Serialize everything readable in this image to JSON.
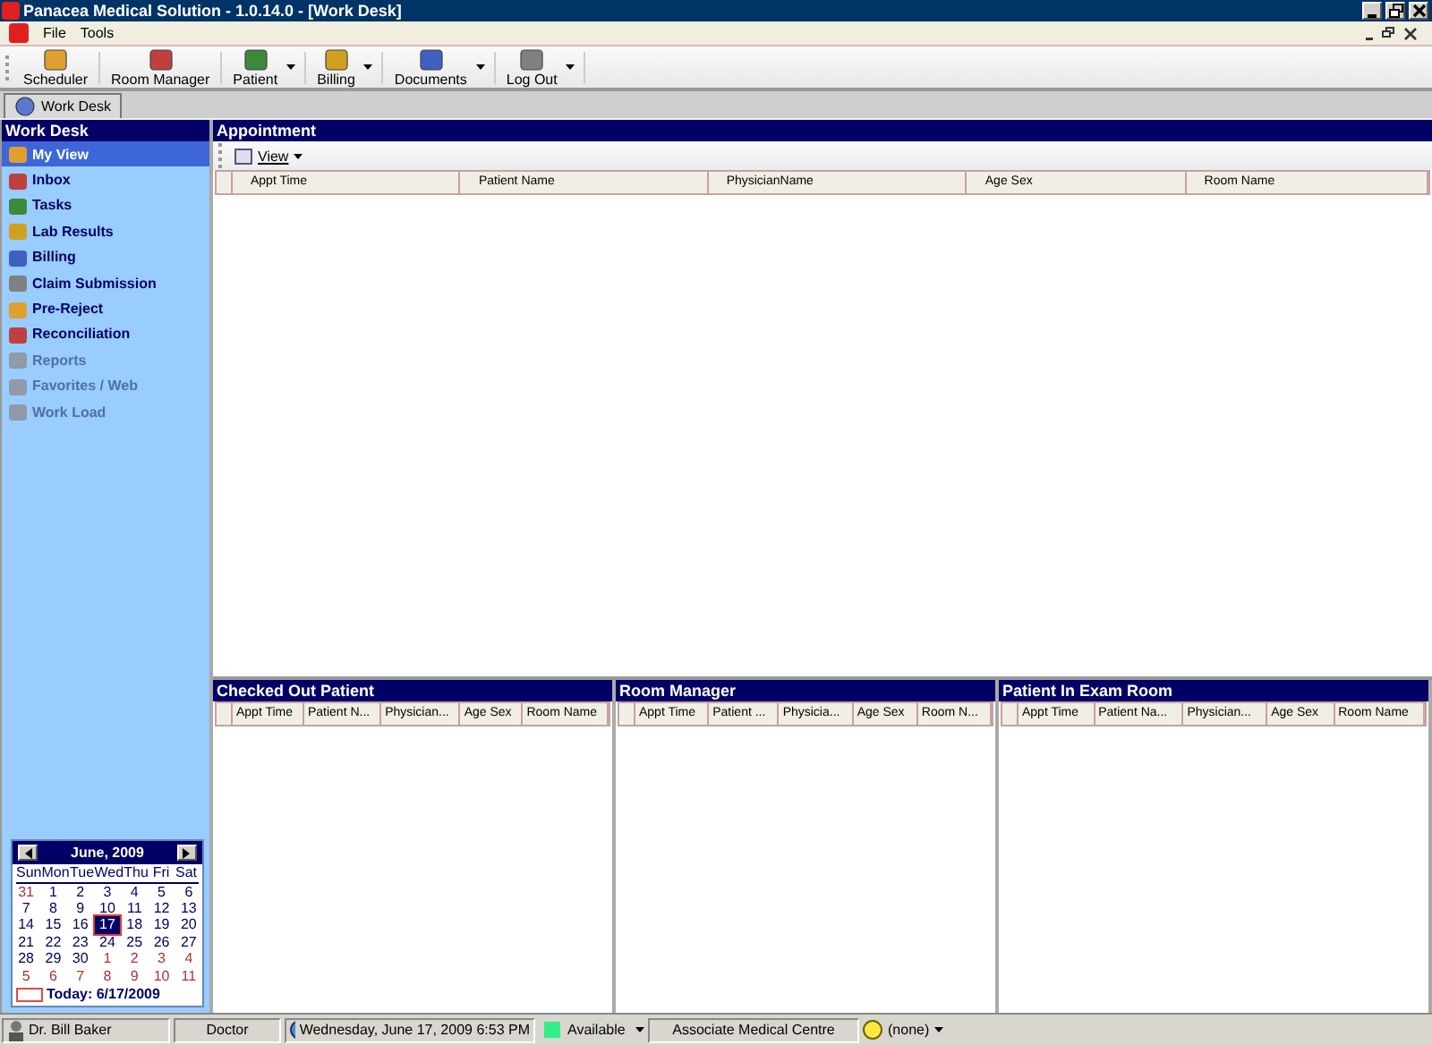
{
  "window": {
    "title": "Panacea Medical Solution - 1.0.14.0 - [Work Desk]"
  },
  "menu": [
    "File",
    "Tools"
  ],
  "toolbar": [
    {
      "label": "Scheduler",
      "dropdown": false
    },
    {
      "label": "Room Manager",
      "dropdown": false
    },
    {
      "label": "Patient",
      "dropdown": true
    },
    {
      "label": "Billing",
      "dropdown": true
    },
    {
      "label": "Documents",
      "dropdown": true
    },
    {
      "label": "Log Out",
      "dropdown": true
    }
  ],
  "doc_tabs": [
    {
      "label": "Work Desk",
      "selected": true
    }
  ],
  "sidebar": {
    "title": "Work Desk",
    "items": [
      {
        "label": "My View",
        "selected": true,
        "disabled": false
      },
      {
        "label": "Inbox",
        "selected": false,
        "disabled": false
      },
      {
        "label": "Tasks",
        "selected": false,
        "disabled": false
      },
      {
        "label": "Lab Results",
        "selected": false,
        "disabled": false
      },
      {
        "label": "Billing",
        "selected": false,
        "disabled": false
      },
      {
        "label": "Claim Submission",
        "selected": false,
        "disabled": false
      },
      {
        "label": "Pre-Reject",
        "selected": false,
        "disabled": false
      },
      {
        "label": "Reconciliation",
        "selected": false,
        "disabled": false
      },
      {
        "label": "Reports",
        "selected": false,
        "disabled": true
      },
      {
        "label": "Favorites / Web",
        "selected": false,
        "disabled": true
      },
      {
        "label": "Work Load",
        "selected": false,
        "disabled": true
      }
    ]
  },
  "calendar": {
    "title": "June, 2009",
    "weekdays": [
      "Sun",
      "Mon",
      "Tue",
      "Wed",
      "Thu",
      "Fri",
      "Sat"
    ],
    "weeks": [
      [
        {
          "label": "31",
          "other_month": true,
          "selected": false
        },
        {
          "label": "1",
          "other_month": false,
          "selected": false
        },
        {
          "label": "2",
          "other_month": false,
          "selected": false
        },
        {
          "label": "3",
          "other_month": false,
          "selected": false
        },
        {
          "label": "4",
          "other_month": false,
          "selected": false
        },
        {
          "label": "5",
          "other_month": false,
          "selected": false
        },
        {
          "label": "6",
          "other_month": false,
          "selected": false
        }
      ],
      [
        {
          "label": "7",
          "other_month": false,
          "selected": false
        },
        {
          "label": "8",
          "other_month": false,
          "selected": false
        },
        {
          "label": "9",
          "other_month": false,
          "selected": false
        },
        {
          "label": "10",
          "other_month": false,
          "selected": false
        },
        {
          "label": "11",
          "other_month": false,
          "selected": false
        },
        {
          "label": "12",
          "other_month": false,
          "selected": false
        },
        {
          "label": "13",
          "other_month": false,
          "selected": false
        }
      ],
      [
        {
          "label": "14",
          "other_month": false,
          "selected": false
        },
        {
          "label": "15",
          "other_month": false,
          "selected": false
        },
        {
          "label": "16",
          "other_month": false,
          "selected": false
        },
        {
          "label": "17",
          "other_month": false,
          "selected": true
        },
        {
          "label": "18",
          "other_month": false,
          "selected": false
        },
        {
          "label": "19",
          "other_month": false,
          "selected": false
        },
        {
          "label": "20",
          "other_month": false,
          "selected": false
        }
      ],
      [
        {
          "label": "21",
          "other_month": false,
          "selected": false
        },
        {
          "label": "22",
          "other_month": false,
          "selected": false
        },
        {
          "label": "23",
          "other_month": false,
          "selected": false
        },
        {
          "label": "24",
          "other_month": false,
          "selected": false
        },
        {
          "label": "25",
          "other_month": false,
          "selected": false
        },
        {
          "label": "26",
          "other_month": false,
          "selected": false
        },
        {
          "label": "27",
          "other_month": false,
          "selected": false
        }
      ],
      [
        {
          "label": "28",
          "other_month": false,
          "selected": false
        },
        {
          "label": "29",
          "other_month": false,
          "selected": false
        },
        {
          "label": "30",
          "other_month": false,
          "selected": false
        },
        {
          "label": "1",
          "other_month": true,
          "selected": false
        },
        {
          "label": "2",
          "other_month": true,
          "selected": false
        },
        {
          "label": "3",
          "other_month": true,
          "selected": false
        },
        {
          "label": "4",
          "other_month": true,
          "selected": false
        }
      ],
      [
        {
          "label": "5",
          "other_month": true,
          "selected": false
        },
        {
          "label": "6",
          "other_month": true,
          "selected": false
        },
        {
          "label": "7",
          "other_month": true,
          "selected": false
        },
        {
          "label": "8",
          "other_month": true,
          "selected": false
        },
        {
          "label": "9",
          "other_month": true,
          "selected": false
        },
        {
          "label": "10",
          "other_month": true,
          "selected": false
        },
        {
          "label": "11",
          "other_month": true,
          "selected": false
        }
      ]
    ],
    "today": "Today: 6/17/2009"
  },
  "appointment": {
    "title": "Appointment",
    "view_button": "View",
    "columns": [
      "Appt Time",
      "Patient Name",
      "PhysicianName",
      "Age Sex",
      "Room Name"
    ]
  },
  "bottom_panels": [
    {
      "title": "Checked Out Patient",
      "columns": [
        "Appt Time",
        "Patient N...",
        "Physician...",
        "Age Sex",
        "Room Name"
      ]
    },
    {
      "title": "Room Manager",
      "columns": [
        "Appt Time",
        "Patient ...",
        "Physicia...",
        "Age Sex",
        "Room N..."
      ]
    },
    {
      "title": "Patient In Exam Room",
      "columns": [
        "Appt Time",
        "Patient Na...",
        "Physician...",
        "Age Sex",
        "Room Name"
      ]
    }
  ],
  "status_bar": {
    "user": "Dr. Bill Baker",
    "role": "Doctor",
    "datetime": "Wednesday, June 17, 2009 6:53 PM",
    "availability": "Available",
    "location": "Associate Medical Centre",
    "extra": "(none)"
  }
}
